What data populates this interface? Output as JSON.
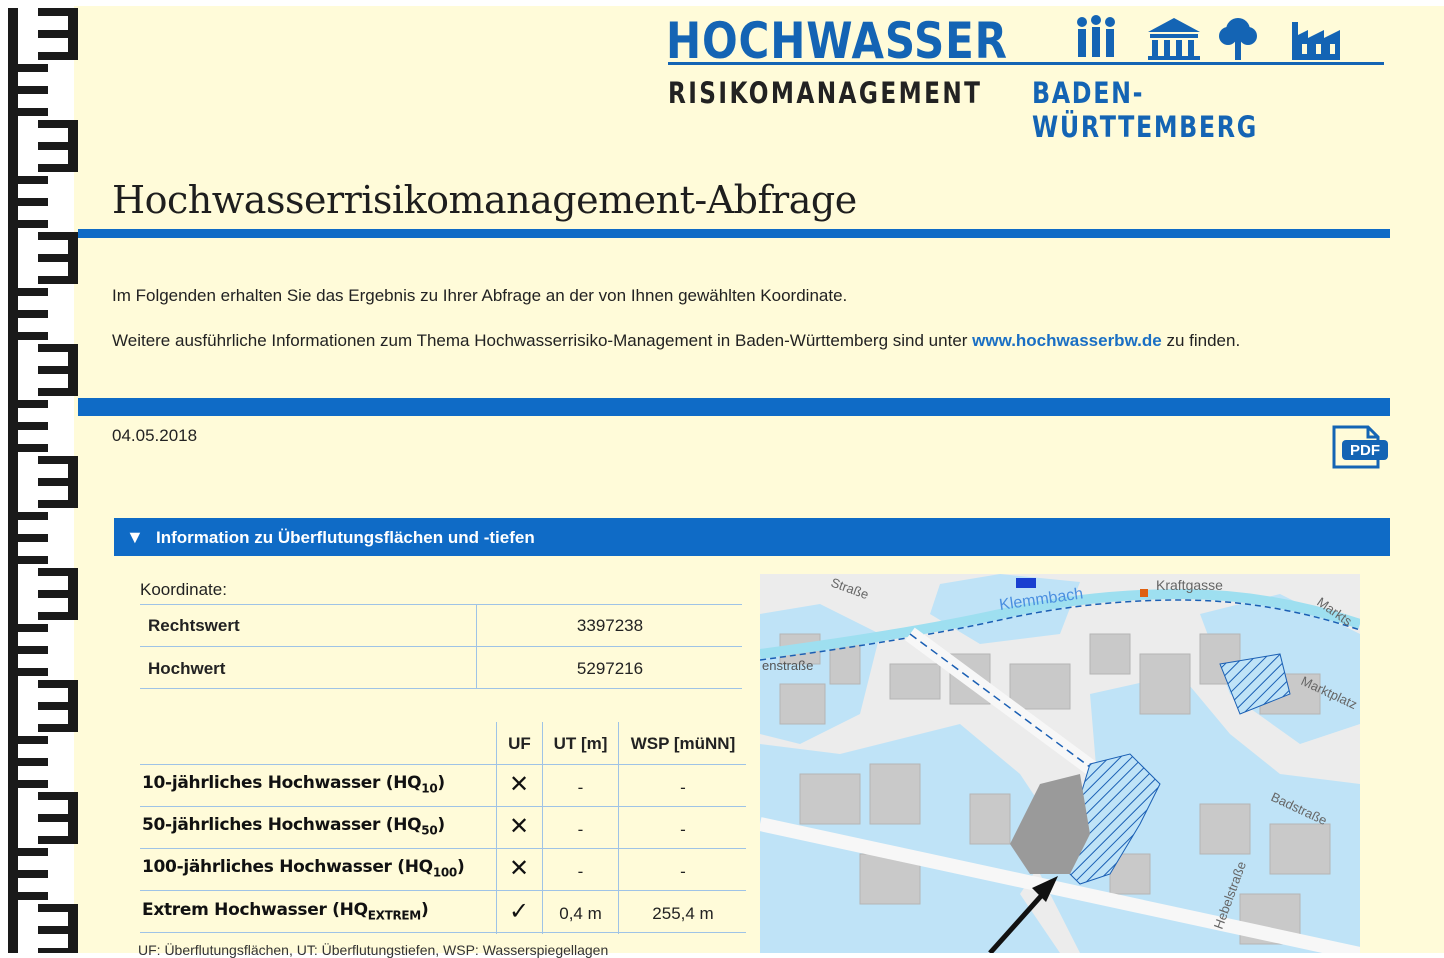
{
  "logo": {
    "title": "HOCHWASSER",
    "sub1": "RISIKOMANAGEMENT",
    "sub2": "BADEN-WÜRTTEMBERG",
    "brand_color": "#1464b4"
  },
  "page_title": "Hochwasserrisikomanagement-Abfrage",
  "intro": {
    "line1": "Im Folgenden erhalten Sie das Ergebnis zu Ihrer Abfrage an der von Ihnen gewählten Koordinate.",
    "line2_pre": "Weitere ausführliche Informationen zum Thema Hochwasserrisiko-Management in Baden-Württemberg sind unter ",
    "line2_link": "www.hochwasserbw.de",
    "line2_post": " zu finden."
  },
  "date": "04.05.2018",
  "pdf_icon": {
    "name": "pdf-icon",
    "label": "PDF"
  },
  "panel": {
    "title": "Information zu Überflutungsflächen und -tiefen",
    "toggle_icon": "triangle-down-icon",
    "koordinate_label": "Koordinate:",
    "coords": [
      {
        "label": "Rechtswert",
        "value": "3397238"
      },
      {
        "label": "Hochwert",
        "value": "5297216"
      }
    ],
    "columns": [
      "UF",
      "UT [m]",
      "WSP [müNN]"
    ],
    "rows": [
      {
        "label": "10-jährliches Hochwasser (HQ",
        "sub": "10",
        "close": ")",
        "uf": "✕",
        "ut": "-",
        "wsp": "-"
      },
      {
        "label": "50-jährliches Hochwasser (HQ",
        "sub": "50",
        "close": ")",
        "uf": "✕",
        "ut": "-",
        "wsp": "-"
      },
      {
        "label": "100-jährliches Hochwasser (HQ",
        "sub": "100",
        "close": ")",
        "uf": "✕",
        "ut": "-",
        "wsp": "-"
      },
      {
        "label": "Extrem Hochwasser (HQ",
        "sub": "EXTREM",
        "close": ")",
        "uf": "✓",
        "ut": "0,4 m",
        "wsp": "255,4 m"
      }
    ],
    "footnote": "UF: Überflutungsflächen, UT: Überflutungstiefen, WSP: Wasserspiegellagen"
  },
  "map": {
    "labels": [
      "Klemmbach",
      "Kraftgasse",
      "Markts",
      "enstraße",
      "Marktplatz",
      "Badstraße",
      "Hebelstraße",
      "Straße"
    ],
    "water_color": "#bfe3f7",
    "hatch_color": "#1a5fb4"
  }
}
